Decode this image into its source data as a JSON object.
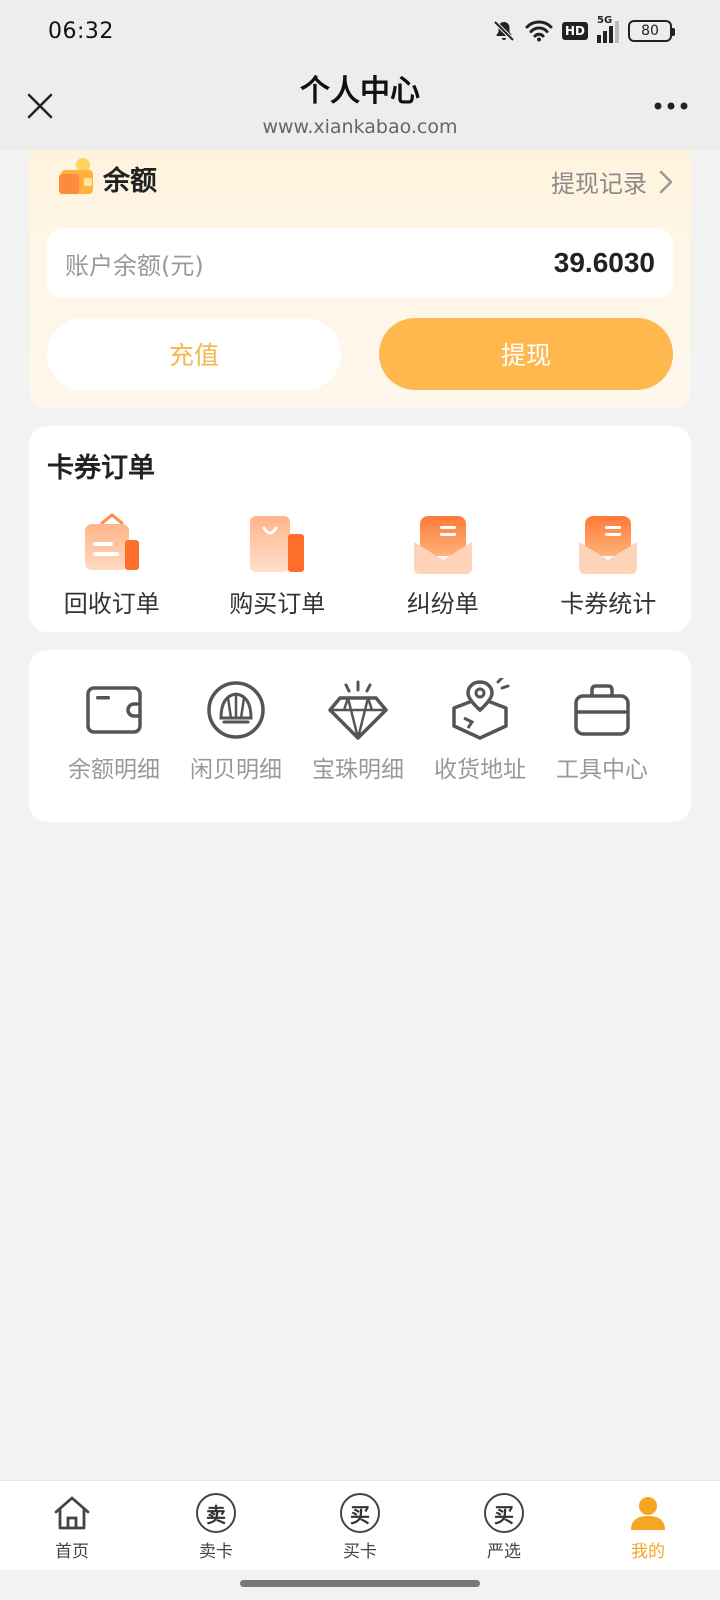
{
  "status_bar": {
    "time": "06:32",
    "hd_label": "HD",
    "network_label": "5G",
    "battery": "80"
  },
  "header": {
    "title": "个人中心",
    "url": "www.xiankabao.com"
  },
  "balance": {
    "title": "余额",
    "withdraw_record": "提现记录",
    "account_label": "账户余额(元)",
    "account_value": "39.6030",
    "recharge_label": "充值",
    "withdraw_label": "提现"
  },
  "orders": {
    "title": "卡券订单",
    "items": [
      {
        "label": "回收订单"
      },
      {
        "label": "购买订单"
      },
      {
        "label": "纠纷单"
      },
      {
        "label": "卡券统计"
      }
    ]
  },
  "tools": {
    "items": [
      {
        "label": "余额明细"
      },
      {
        "label": "闲贝明细"
      },
      {
        "label": "宝珠明细"
      },
      {
        "label": "收货地址"
      },
      {
        "label": "工具中心"
      }
    ]
  },
  "tabbar": {
    "items": [
      {
        "label": "首页"
      },
      {
        "label": "卖卡",
        "glyph": "卖"
      },
      {
        "label": "买卡",
        "glyph": "买"
      },
      {
        "label": "严选",
        "glyph": "买"
      },
      {
        "label": "我的"
      }
    ]
  },
  "colors": {
    "accent": "#ffb84d",
    "accent_text": "#f5a623"
  }
}
